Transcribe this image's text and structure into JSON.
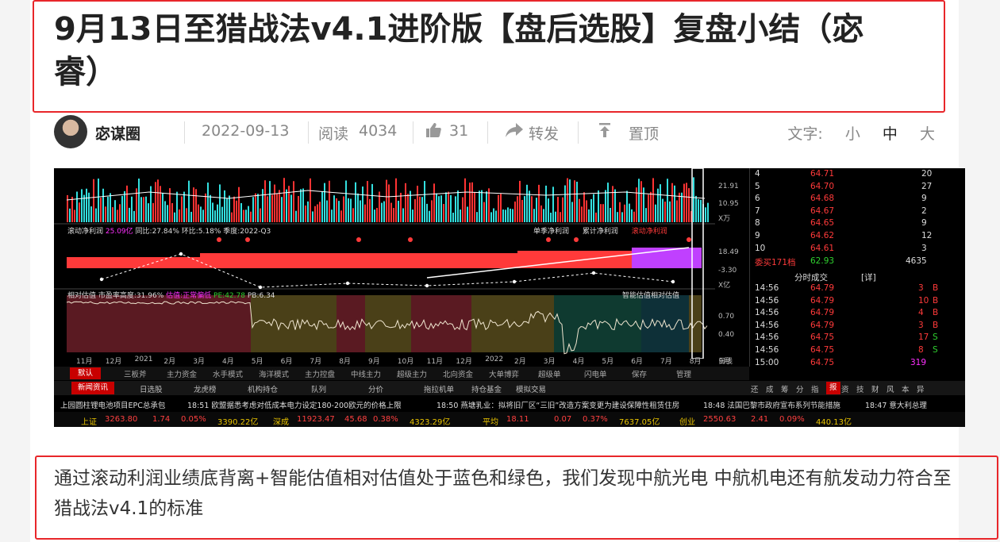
{
  "article": {
    "title": "9月13日至猎战法v4.1进阶版【盘后选股】复盘小结（宓睿）",
    "author": "宓谋圈",
    "date": "2022-09-13",
    "reads_label": "阅读",
    "reads": "4034",
    "likes": "31",
    "share": "转发",
    "pin": "置顶",
    "font_label": "文字:",
    "font_small": "小",
    "font_medium": "中",
    "font_large": "大",
    "body": "通过滚动利润业绩底背离+智能估值相对估值处于蓝色和绿色，我们发现中航光电 中航机电还有航发动力符合至猎战法v4.1的标准"
  },
  "screenshot": {
    "vol_labels": [
      "21.91",
      "10.95",
      "X万"
    ],
    "profit_header": {
      "name": "滚动净利润",
      "val": "25.09亿",
      "yoy": "同比:27.84%",
      "qoq": "环比:5.18%",
      "quarter": "季度:2022-Q3"
    },
    "profit_tabs": [
      "单季净利润",
      "累计净利润",
      "滚动净利润"
    ],
    "profit_axis": [
      "18.49",
      "-3.30",
      "X亿"
    ],
    "val_header": {
      "name": "相对估值",
      "pct": "市盈率高度:31.96%",
      "est": "估值:正常偏低",
      "pe": "PE:42.78",
      "pb": "PB:6.34",
      "right": "智能估值相对估值"
    },
    "val_axis": [
      "0.70",
      "0.40"
    ],
    "x_labels": [
      "11月",
      "12月",
      "2021",
      "2月",
      "3月",
      "4月",
      "5月",
      "6月",
      "7月",
      "8月",
      "9月",
      "10月",
      "11月",
      "12月",
      "2022",
      "2月",
      "3月",
      "4月",
      "5月",
      "6月",
      "7月",
      "8月",
      "9月"
    ],
    "period": "日线",
    "tabs1": [
      "默认",
      "三板斧",
      "主力资金",
      "水手模式",
      "海洋模式",
      "主力控盘",
      "中线主力",
      "超级主力",
      "北向资金",
      "大单博弈",
      "超级单",
      "闪电单",
      "保存",
      "管理"
    ],
    "tabs2": [
      "新闻资讯",
      "日选股",
      "龙虎榜",
      "机构持仓",
      "队列",
      "分价",
      "拖拉机单",
      "持仓基金",
      "模拟交易"
    ],
    "right_tabs": [
      "还",
      "成",
      "筹",
      "分",
      "指",
      "报",
      "资",
      "技",
      "财",
      "风",
      "本",
      "异"
    ],
    "ticker": [
      "上园圆柱锂电池项目EPC总承包",
      "18:51 欧盟据悉考虑对低成本电力设定180-200欧元的价格上限",
      "18:50 燕塘乳业：拟将旧厂区“三旧”改造方案变更为建设保障性租赁住房",
      "18:48 法国巴黎市政府宣布系列节能措施",
      "18:47 意大利总理"
    ],
    "indices": [
      {
        "name": "上证",
        "price": "3263.80",
        "chg": "1.74",
        "pct": "0.05%",
        "vol": "3390.22亿"
      },
      {
        "name": "深成",
        "price": "11923.47",
        "chg": "45.68",
        "pct": "0.38%",
        "vol": "4323.29亿"
      },
      {
        "name": "平均",
        "price": "18.11",
        "chg": "0.07",
        "pct": "0.37%",
        "vol": "7637.05亿"
      },
      {
        "name": "创业",
        "price": "2550.63",
        "chg": "2.41",
        "pct": "0.09%",
        "vol": "440.13亿"
      }
    ],
    "asks": [
      {
        "lvl": "4",
        "price": "64.71",
        "qty": "20"
      },
      {
        "lvl": "5",
        "price": "64.70",
        "qty": "27"
      },
      {
        "lvl": "6",
        "price": "64.68",
        "qty": "9"
      },
      {
        "lvl": "7",
        "price": "64.67",
        "qty": "2"
      },
      {
        "lvl": "8",
        "price": "64.65",
        "qty": "9"
      },
      {
        "lvl": "9",
        "price": "64.62",
        "qty": "12"
      },
      {
        "lvl": "10",
        "price": "64.61",
        "qty": "3"
      }
    ],
    "weibi": {
      "label": "委买171档",
      "price": "62.93",
      "qty": "4635"
    },
    "trades_header": "分时成交",
    "trades_tag": "[详]",
    "trades": [
      {
        "t": "14:56",
        "p": "64.79",
        "q": "3",
        "s": "B"
      },
      {
        "t": "14:56",
        "p": "64.79",
        "q": "10",
        "s": "B"
      },
      {
        "t": "14:56",
        "p": "64.79",
        "q": "4",
        "s": "B"
      },
      {
        "t": "14:56",
        "p": "64.79",
        "q": "3",
        "s": "B"
      },
      {
        "t": "14:56",
        "p": "64.75",
        "q": "17",
        "s": "S"
      },
      {
        "t": "14:56",
        "p": "64.75",
        "q": "8",
        "s": "S"
      },
      {
        "t": "15:00",
        "p": "64.75",
        "q": "319",
        "s": ""
      }
    ]
  }
}
